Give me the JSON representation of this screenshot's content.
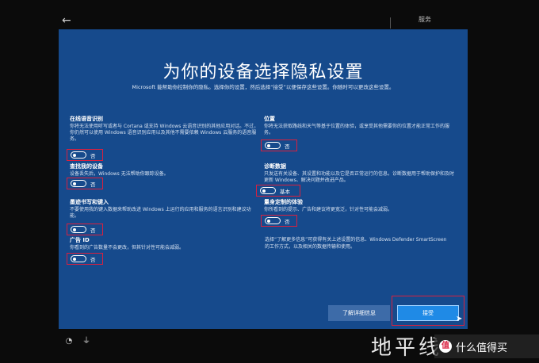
{
  "topbar": {
    "back_icon": "←",
    "section_label": "服务"
  },
  "header": {
    "title": "为你的设备选择隐私设置",
    "subtitle": "Microsoft 能帮助你控制你的隐私。选择你的设置，然后选择“接受”以便保存这些设置。你随时可以更改这些设置。"
  },
  "settings": {
    "speech": {
      "title": "在线语音识别",
      "desc": "你将无法使用听写或者与 Cortana 或支持 Windows 云语音识别的其他应用对话。不过，你仍然可以使用 Windows 语音识别应用以及其他不需要依赖 Windows 云服务的语音服务。",
      "state": "否"
    },
    "find_device": {
      "title": "查找我的设备",
      "desc": "设备丢失后，Windows 无法帮助你跟踪设备。",
      "state": "否"
    },
    "inking": {
      "title": "墨迹书写和键入",
      "desc": "不要使用我的键入数据来帮助改进 Windows 上运行的应用和服务的语言识别和建议功能。",
      "state": "否"
    },
    "ad_id": {
      "title": "广告 ID",
      "desc": "你看到的广告数量不会更改，但其针对性可能会减弱。",
      "state": "否"
    },
    "location": {
      "title": "位置",
      "desc": "你将无法获取路线和天气等基于位置的体验，或享受其他需要你的位置才能正常工作的服务。",
      "state": "否"
    },
    "diagnostics": {
      "title": "诊断数据",
      "desc": "只发送有关设备、其设置和功能以及它是否正常运行的信息。诊断数据用于帮助保护和及时更新 Windows、解决问题并改进产品。",
      "state": "基本"
    },
    "tailored": {
      "title": "量身定制的体验",
      "desc": "你所看到的提示、广告和建议将更宽泛，针对性可能会减弱。",
      "state": "否"
    }
  },
  "footer": {
    "note": "选择“了解更多信息”可获得有关上述设置的信息、Windows Defender SmartScreen 的工作方式，以及相关的数据传输和使用。",
    "learn_more_label": "了解详细信息",
    "accept_label": "接受"
  },
  "bottom": {
    "ease_icon": "◔",
    "mic_icon": "⏚"
  },
  "watermark": {
    "text": "地平线",
    "badge_icon": "值",
    "badge_text": "什么值得买"
  },
  "colors": {
    "panel": "#164a8c",
    "highlight": "#d9203f",
    "accept": "#1f8ae6"
  }
}
